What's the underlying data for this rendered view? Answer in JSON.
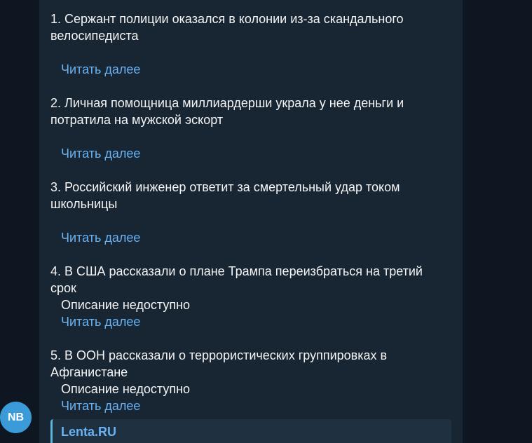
{
  "colors": {
    "background": "#0e1621",
    "bubble": "#182533",
    "text": "#f5f5f5",
    "link": "#6ab3f3",
    "preview_bar": "#5bb5d8",
    "avatar": "#3a9bd8"
  },
  "message": {
    "items": [
      {
        "title_line1": "1. Сержант полиции оказался в колонии из-за скандального",
        "title_line2": "велосипедиста",
        "description": "",
        "read_more": "Читать далее"
      },
      {
        "title_line1": "2. Личная помощница миллиардерши украла у нее деньги и",
        "title_line2": "потратила на мужской эскорт",
        "description": "",
        "read_more": "Читать далее"
      },
      {
        "title_line1": "3. Российский инженер ответит за смертельный удар током",
        "title_line2": "школьницы",
        "description": "",
        "read_more": "Читать далее"
      },
      {
        "title_line1": "4. В США рассказали о плане Трампа переизбраться на третий",
        "title_line2": "срок",
        "description": "Описание недоступно",
        "read_more": "Читать далее"
      },
      {
        "title_line1": "5. В ООН рассказали о террористических группировках в",
        "title_line2": "Афганистане",
        "description": "Описание недоступно",
        "read_more": "Читать далее"
      }
    ],
    "link_preview": {
      "site_name": "Lenta.RU"
    }
  },
  "avatar": {
    "initials": "NB"
  }
}
